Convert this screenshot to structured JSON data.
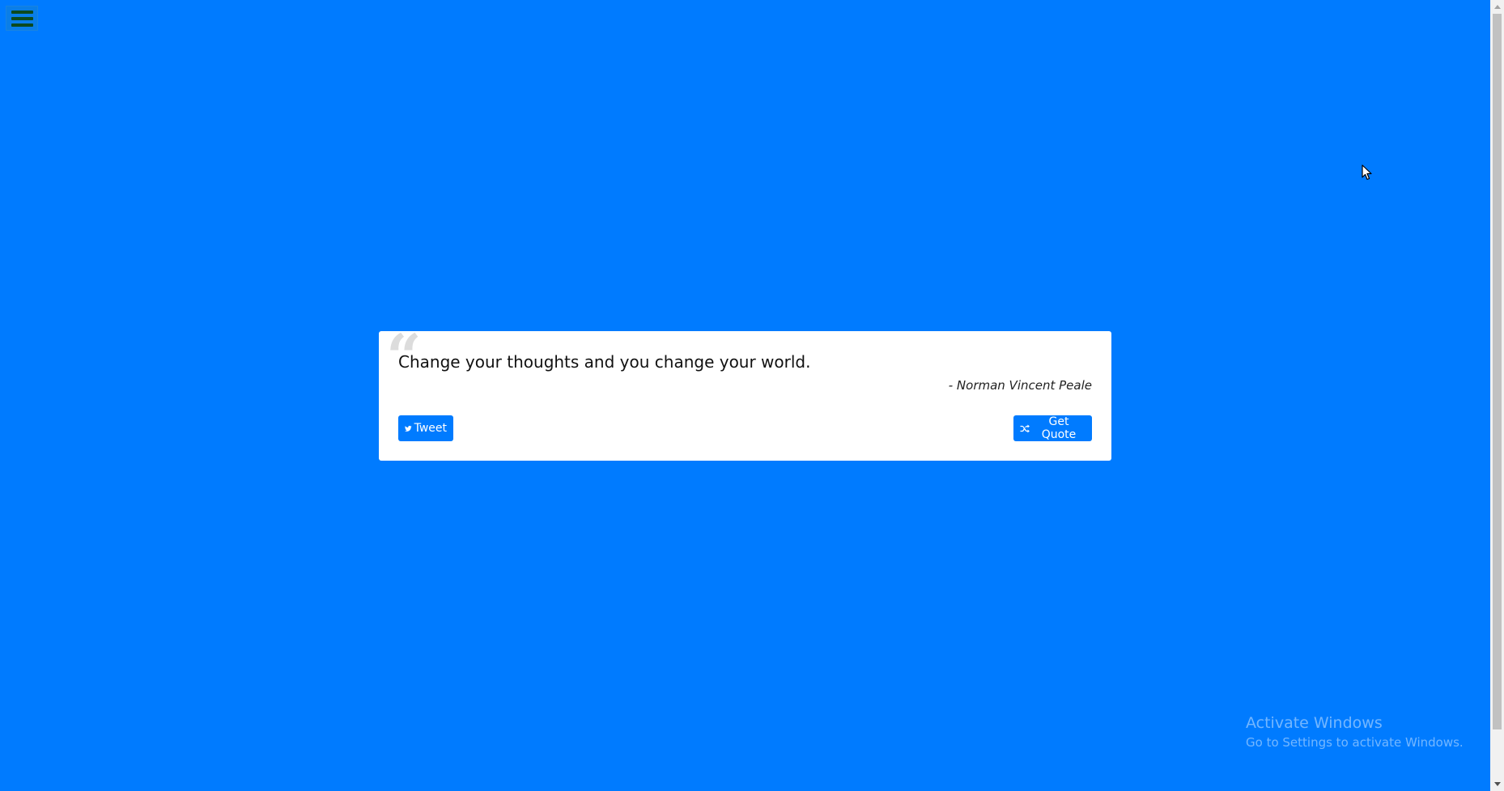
{
  "menu": {
    "icon": "hamburger-icon"
  },
  "quote": {
    "text": "Change your thoughts and you change your world.",
    "author": "- Norman Vincent Peale",
    "quote_mark": "“"
  },
  "buttons": {
    "tweet_label": "Tweet",
    "tweet_icon": "twitter-icon",
    "get_quote_label": "Get Quote",
    "get_quote_icon": "shuffle-icon"
  },
  "watermark": {
    "title": "Activate Windows",
    "subtitle": "Go to Settings to activate Windows."
  },
  "colors": {
    "background": "#007bff",
    "card": "#ffffff",
    "button": "#007bff",
    "menu_bars": "#0c4a1f"
  }
}
